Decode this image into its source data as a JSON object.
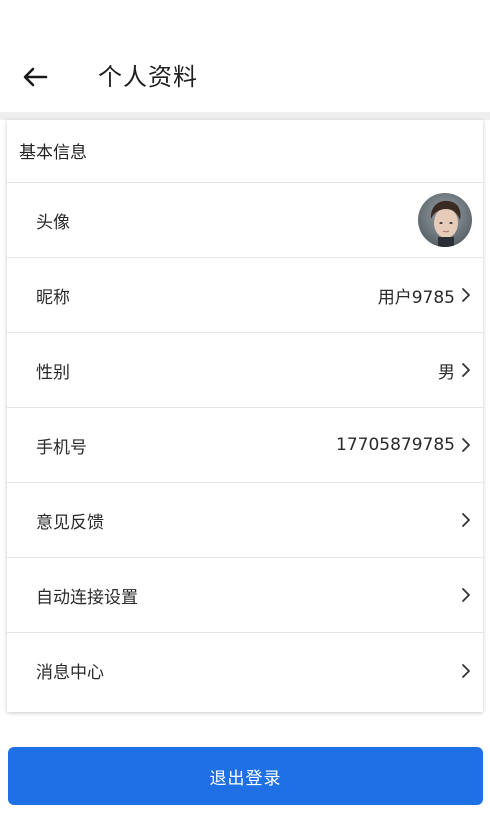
{
  "header": {
    "title": "个人资料",
    "back_icon": "arrow-left-icon"
  },
  "section": {
    "title": "基本信息"
  },
  "rows": [
    {
      "label": "头像",
      "value": "",
      "type": "avatar"
    },
    {
      "label": "昵称",
      "value": "用户9785"
    },
    {
      "label": "性别",
      "value": "男"
    },
    {
      "label": "手机号",
      "value": "17705879785"
    },
    {
      "label": "意见反馈",
      "value": ""
    },
    {
      "label": "自动连接设置",
      "value": ""
    },
    {
      "label": "消息中心",
      "value": ""
    }
  ],
  "logout": {
    "label": "退出登录"
  },
  "colors": {
    "primary": "#1f6fe5",
    "divider": "#e6e6e6",
    "background_band": "#eeeeee"
  }
}
